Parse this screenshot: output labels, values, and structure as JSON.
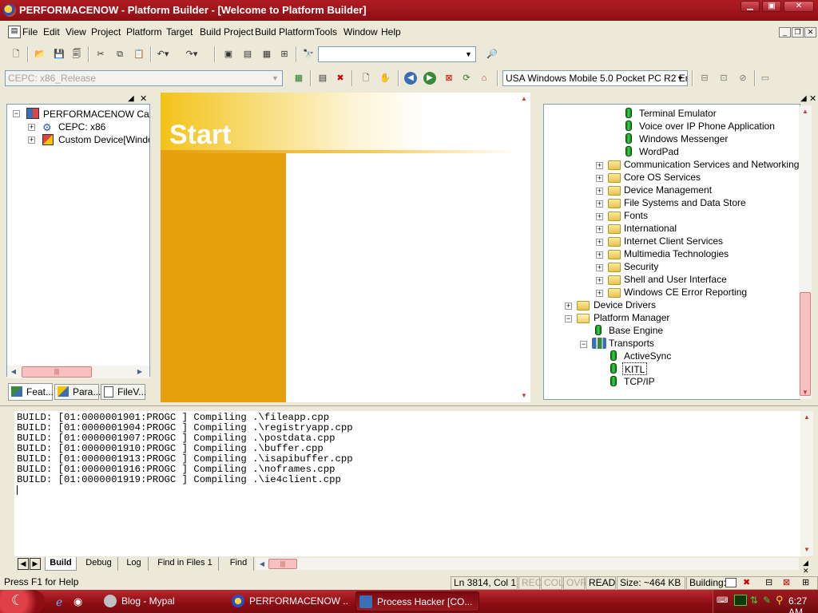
{
  "window": {
    "title": "PERFORMACENOW - Platform Builder - [Welcome to Platform Builder]"
  },
  "menu": [
    "File",
    "Edit",
    "View",
    "Project",
    "Platform",
    "Target",
    "Build Project",
    "Build Platform",
    "Tools",
    "Window",
    "Help"
  ],
  "toolbar": {
    "find_combo_value": "",
    "config_combo": "CEPC: x86_Release",
    "device_combo": "USA Windows Mobile 5.0 Pocket PC R2 Em"
  },
  "workspace_tree": {
    "root": "PERFORMACENOW Catal",
    "children": [
      "CEPC: x86",
      "Custom Device[Windov"
    ]
  },
  "workspace_tabs": [
    "Feat...",
    "Para...",
    "FileV..."
  ],
  "start_page": {
    "title": "Start"
  },
  "catalog_tree": {
    "items": [
      {
        "label": "Terminal Emulator",
        "kind": "component"
      },
      {
        "label": "Voice over IP Phone Application",
        "kind": "component"
      },
      {
        "label": "Windows Messenger",
        "kind": "component"
      },
      {
        "label": "WordPad",
        "kind": "component"
      },
      {
        "label": "Communication Services and Networking",
        "kind": "folder"
      },
      {
        "label": "Core OS Services",
        "kind": "folder"
      },
      {
        "label": "Device Management",
        "kind": "folder"
      },
      {
        "label": "File Systems and Data Store",
        "kind": "folder"
      },
      {
        "label": "Fonts",
        "kind": "folder"
      },
      {
        "label": "International",
        "kind": "folder"
      },
      {
        "label": "Internet Client Services",
        "kind": "folder"
      },
      {
        "label": "Multimedia Technologies",
        "kind": "folder"
      },
      {
        "label": "Security",
        "kind": "folder"
      },
      {
        "label": "Shell and User Interface",
        "kind": "folder"
      },
      {
        "label": "Windows CE Error Reporting",
        "kind": "folder"
      },
      {
        "label": "Device Drivers",
        "kind": "folder"
      },
      {
        "label": "Platform Manager",
        "kind": "folder-open"
      },
      {
        "label": "Base Engine",
        "kind": "component"
      },
      {
        "label": "Transports",
        "kind": "group"
      },
      {
        "label": "ActiveSync",
        "kind": "component"
      },
      {
        "label": "KITL",
        "kind": "component-selected"
      },
      {
        "label": "TCP/IP",
        "kind": "component"
      }
    ]
  },
  "output": {
    "lines": [
      "BUILD: [01:0000001901:PROGC ] Compiling .\\fileapp.cpp",
      "BUILD: [01:0000001904:PROGC ] Compiling .\\registryapp.cpp",
      "BUILD: [01:0000001907:PROGC ] Compiling .\\postdata.cpp",
      "BUILD: [01:0000001910:PROGC ] Compiling .\\buffer.cpp",
      "BUILD: [01:0000001913:PROGC ] Compiling .\\isapibuffer.cpp",
      "BUILD: [01:0000001916:PROGC ] Compiling .\\noframes.cpp",
      "BUILD: [01:0000001919:PROGC ] Compiling .\\ie4client.cpp"
    ],
    "tabs": [
      "Build",
      "Debug",
      "Log",
      "Find in Files 1",
      "Find"
    ]
  },
  "status": {
    "help": "Press F1 for Help",
    "position": "Ln 3814, Col 1",
    "rec": "REC",
    "col": "COL",
    "ovr": "OVR",
    "read": "READ",
    "size": "Size: ~464 KB",
    "building": "Building:"
  },
  "taskbar": {
    "tasks": [
      "Blog - Mypal",
      "PERFORMACENOW ...",
      "Process Hacker [CO..."
    ],
    "clock": "6:27 AM"
  },
  "colors": {
    "title_bar": "#a3161c",
    "start_orange": "#e79e0d",
    "taskbar": "#8b0c12"
  }
}
